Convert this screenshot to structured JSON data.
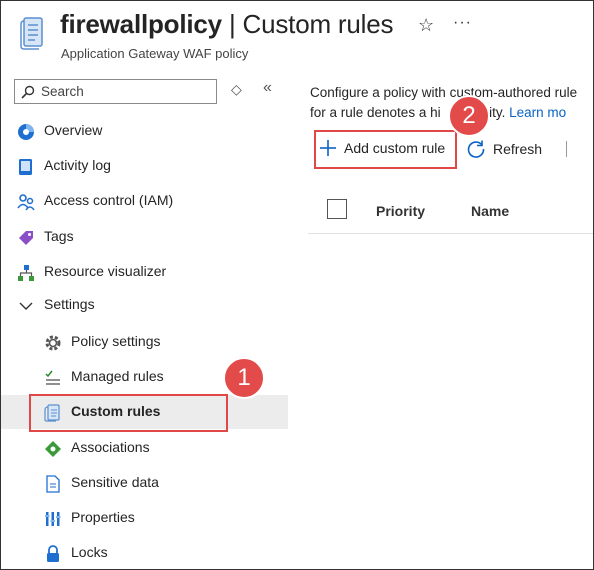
{
  "header": {
    "resource_name": "firewallpolicy",
    "separator": " | ",
    "page_name": "Custom rules",
    "subtitle": "Application Gateway WAF policy",
    "favorite_icon": "star-icon",
    "more_icon": "ellipsis-icon"
  },
  "sidebar": {
    "search_placeholder": "Search",
    "items": [
      {
        "label": "Overview",
        "icon": "overview-icon"
      },
      {
        "label": "Activity log",
        "icon": "activity-log-icon"
      },
      {
        "label": "Access control (IAM)",
        "icon": "people-icon"
      },
      {
        "label": "Tags",
        "icon": "tag-icon"
      },
      {
        "label": "Resource visualizer",
        "icon": "hierarchy-icon"
      }
    ],
    "settings_group": {
      "label": "Settings",
      "expanded": true,
      "items": [
        {
          "label": "Policy settings",
          "icon": "gear-icon"
        },
        {
          "label": "Managed rules",
          "icon": "checklist-icon"
        },
        {
          "label": "Custom rules",
          "icon": "scroll-icon",
          "selected": true
        },
        {
          "label": "Associations",
          "icon": "association-icon"
        },
        {
          "label": "Sensitive data",
          "icon": "document-icon"
        },
        {
          "label": "Properties",
          "icon": "properties-icon"
        },
        {
          "label": "Locks",
          "icon": "lock-icon"
        }
      ]
    }
  },
  "main": {
    "description_line1": "Configure a policy with custom-authored rule",
    "description_line2_prefix": "for a rule denotes a hi",
    "description_line2_suffix": "riority.",
    "learn_more": "Learn mo",
    "commands": {
      "add_label": "Add custom rule",
      "refresh_label": "Refresh"
    },
    "table": {
      "columns": [
        "Priority",
        "Name"
      ]
    }
  },
  "annotations": {
    "badge1": "1",
    "badge2": "2",
    "color": "#e34b4b"
  }
}
